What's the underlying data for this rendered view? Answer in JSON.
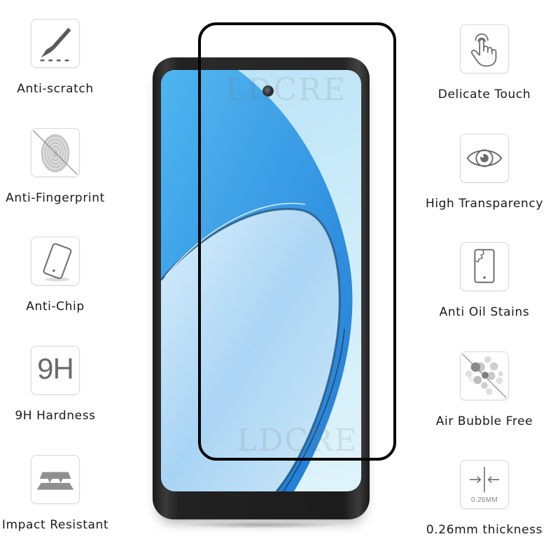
{
  "left_features": [
    {
      "label": "Anti-scratch",
      "icon": "scalpel-scratch-icon"
    },
    {
      "label": "Anti-Fingerprint",
      "icon": "fingerprint-crossed-icon"
    },
    {
      "label": "Anti-Chip",
      "icon": "tilted-phone-icon"
    },
    {
      "label": "9H Hardness",
      "icon": "9h-icon",
      "icon_text": "9H"
    },
    {
      "label": "Impact Resistant",
      "icon": "layered-plates-icon"
    }
  ],
  "right_features": [
    {
      "label": "Delicate Touch",
      "icon": "touch-hand-icon"
    },
    {
      "label": "High Transparency",
      "icon": "eye-icon"
    },
    {
      "label": "Anti Oil Stains",
      "icon": "cracked-phone-icon"
    },
    {
      "label": "Air Bubble Free",
      "icon": "bubbles-crossed-icon"
    },
    {
      "label": "0.26mm thickness",
      "icon": "thickness-arrows-icon",
      "icon_text": "0.26MM"
    }
  ],
  "watermarks": [
    "LDCRE",
    "LDCRE"
  ],
  "colors": {
    "protector_border": "#000000",
    "screen_blue": "#3aa0e8",
    "icon_gray": "#6b6b6b",
    "label_text": "#1a1a1a"
  }
}
